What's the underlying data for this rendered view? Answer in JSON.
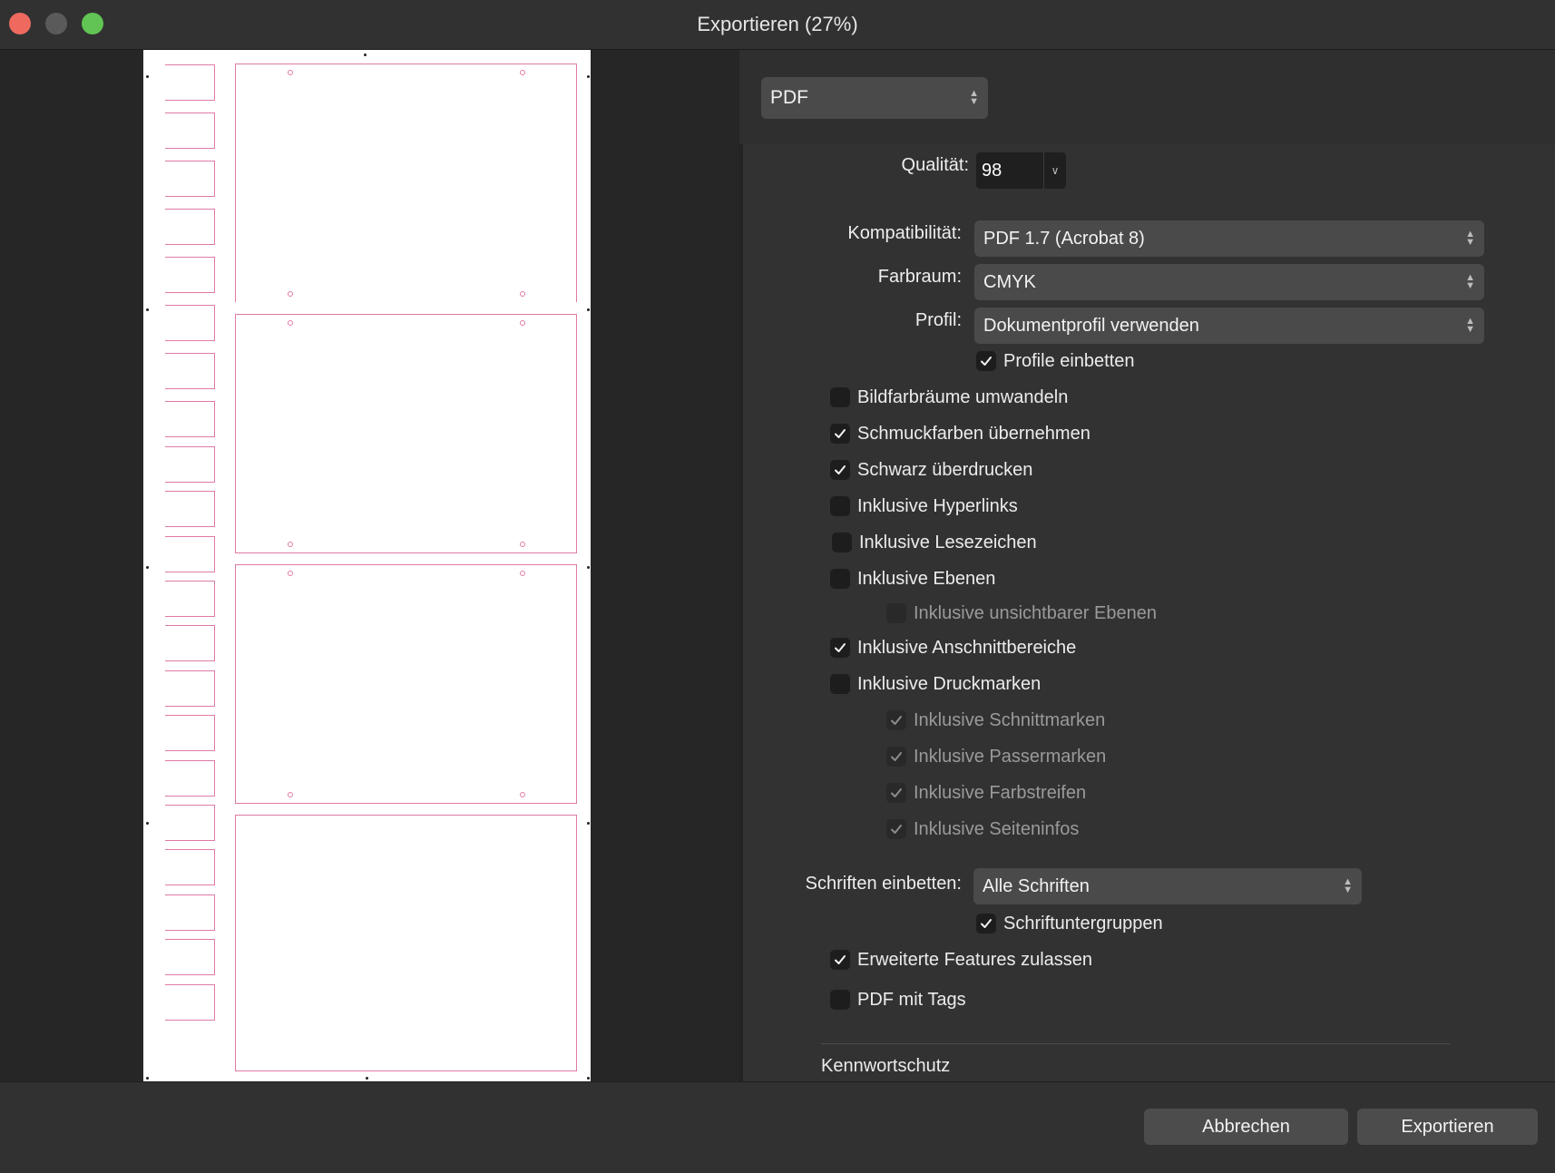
{
  "window": {
    "title": "Exportieren (27%)",
    "traffic_colors": {
      "close": "#ee6a5f",
      "minimize": "#5a5a5a",
      "zoom": "#61c454"
    }
  },
  "format": {
    "value": "PDF"
  },
  "quality": {
    "label": "Qualität:",
    "value": "98"
  },
  "compatibility": {
    "label": "Kompatibilität:",
    "value": "PDF 1.7 (Acrobat 8)"
  },
  "colorspace": {
    "label": "Farbraum:",
    "value": "CMYK"
  },
  "profile": {
    "label": "Profil:",
    "value": "Dokumentprofil verwenden"
  },
  "options": [
    {
      "label": "Profile einbetten",
      "checked": true,
      "enabled": true
    },
    {
      "label": "Bildfarbräume umwandeln",
      "checked": false,
      "enabled": true
    },
    {
      "label": "Schmuckfarben übernehmen",
      "checked": true,
      "enabled": true
    },
    {
      "label": "Schwarz überdrucken",
      "checked": true,
      "enabled": true
    },
    {
      "label": "Inklusive Hyperlinks",
      "checked": false,
      "enabled": true
    },
    {
      "label": "Inklusive Lesezeichen",
      "checked": false,
      "enabled": true
    },
    {
      "label": "Inklusive Ebenen",
      "checked": false,
      "enabled": true
    },
    {
      "label": "Inklusive unsichtbarer Ebenen",
      "checked": false,
      "enabled": false
    },
    {
      "label": "Inklusive Anschnittbereiche",
      "checked": true,
      "enabled": true
    },
    {
      "label": "Inklusive Druckmarken",
      "checked": false,
      "enabled": true
    },
    {
      "label": "Inklusive Schnittmarken",
      "checked": true,
      "enabled": false
    },
    {
      "label": "Inklusive Passermarken",
      "checked": true,
      "enabled": false
    },
    {
      "label": "Inklusive Farbstreifen",
      "checked": true,
      "enabled": false
    },
    {
      "label": "Inklusive Seiteninfos",
      "checked": true,
      "enabled": false
    },
    {
      "label": "Schriftuntergruppen",
      "checked": true,
      "enabled": true
    },
    {
      "label": "Erweiterte Features zulassen",
      "checked": true,
      "enabled": true
    },
    {
      "label": "PDF mit Tags",
      "checked": false,
      "enabled": true
    }
  ],
  "fonts_embed": {
    "label": "Schriften einbetten:",
    "value": "Alle Schriften"
  },
  "password_section": {
    "title": "Kennwortschutz"
  },
  "buttons": {
    "cancel": "Abbrechen",
    "export": "Exportieren"
  },
  "accent_colors": {
    "bleed_lines": "#e07aa6"
  }
}
